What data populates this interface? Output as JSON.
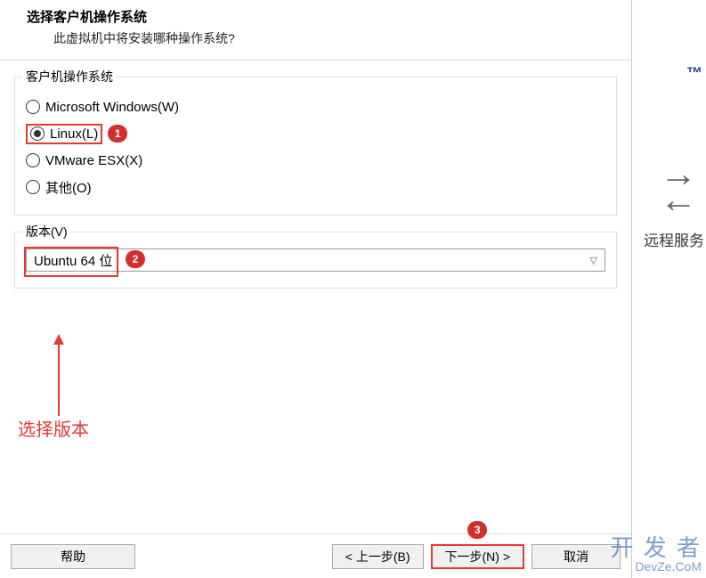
{
  "header": {
    "title": "选择客户机操作系统",
    "subtitle": "此虚拟机中将安装哪种操作系统?"
  },
  "os_group": {
    "label": "客户机操作系统",
    "options": [
      {
        "label": "Microsoft Windows(W)",
        "selected": false
      },
      {
        "label": "Linux(L)",
        "selected": true
      },
      {
        "label": "VMware ESX(X)",
        "selected": false
      },
      {
        "label": "其他(O)",
        "selected": false
      }
    ]
  },
  "version_group": {
    "label": "版本(V)",
    "selected": "Ubuntu 64 位"
  },
  "annotations": {
    "badge1": "1",
    "badge2": "2",
    "badge3": "3",
    "select_version": "选择版本"
  },
  "footer": {
    "help": "帮助",
    "back": "< 上一步(B)",
    "next": "下一步(N) >",
    "cancel": "取消"
  },
  "background": {
    "tm": "™",
    "swap_icon": "⇄",
    "remote": "远程服务",
    "watermark_main": "开 发 者",
    "watermark_sub": "DevZe.CoM"
  }
}
